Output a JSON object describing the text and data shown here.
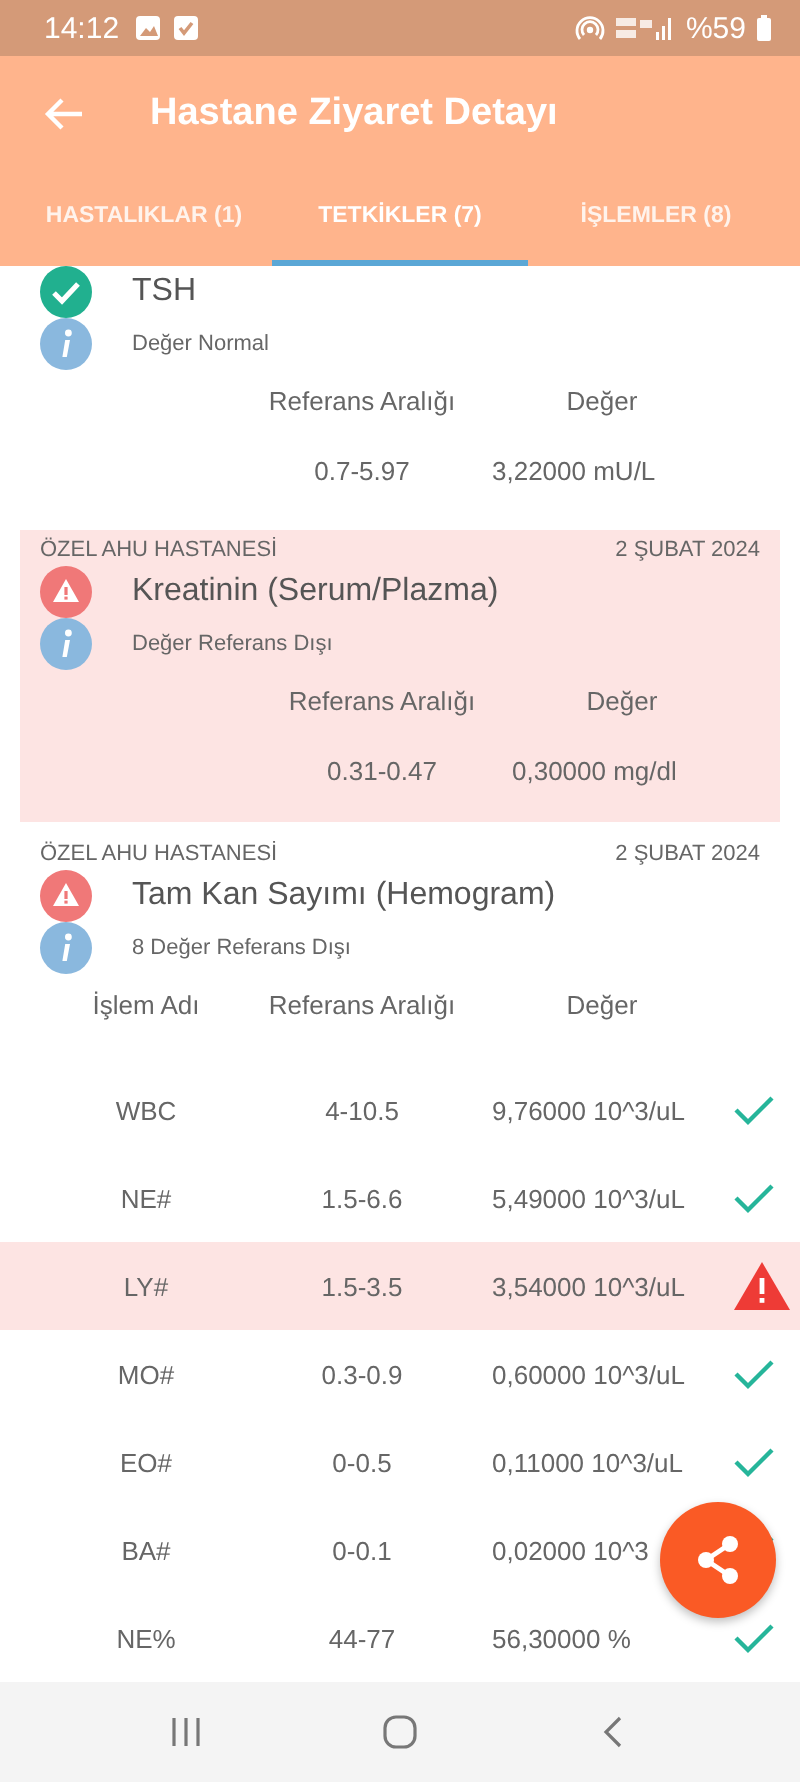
{
  "status_bar": {
    "time": "14:12",
    "battery": "%59"
  },
  "app_bar": {
    "title": "Hastane Ziyaret Detayı"
  },
  "tabs": [
    {
      "label": "HASTALIKLAR (1)",
      "selected": false
    },
    {
      "label": "TETKİKLER (7)",
      "selected": true
    },
    {
      "label": "İŞLEMLER (8)",
      "selected": false
    }
  ],
  "tests": [
    {
      "name": "TSH",
      "kind": "normal",
      "highlighted": false,
      "note": "Değer Normal",
      "columns": [
        "Referans Aralığı",
        "Değer"
      ],
      "rows": [
        {
          "range": "0.7-5.97",
          "value": "3,22000 mU/L"
        }
      ]
    },
    {
      "hospital": "ÖZEL AHU HASTANESİ",
      "date": "2 ŞUBAT 2024",
      "name": "Kreatinin (Serum/Plazma)",
      "kind": "abnormal",
      "highlighted": true,
      "note": "Değer Referans Dışı",
      "columns": [
        "Referans Aralığı",
        "Değer"
      ],
      "rows": [
        {
          "range": "0.31-0.47",
          "value": "0,30000 mg/dl"
        }
      ]
    },
    {
      "hospital": "ÖZEL AHU HASTANESİ",
      "date": "2 ŞUBAT 2024",
      "name": "Tam Kan Sayımı (Hemogram)",
      "kind": "abnormal",
      "highlighted": false,
      "note": "8 Değer Referans Dışı",
      "columns": [
        "İşlem Adı",
        "Referans Aralığı",
        "Değer"
      ],
      "rows": [
        {
          "item": "WBC",
          "range": "4-10.5",
          "value": "9,76000 10^3/uL",
          "kind": "normal"
        },
        {
          "item": "NE#",
          "range": "1.5-6.6",
          "value": "5,49000 10^3/uL",
          "kind": "normal"
        },
        {
          "item": "LY#",
          "range": "1.5-3.5",
          "value": "3,54000 10^3/uL",
          "kind": "abnormal"
        },
        {
          "item": "MO#",
          "range": "0.3-0.9",
          "value": "0,60000 10^3/uL",
          "kind": "normal"
        },
        {
          "item": "EO#",
          "range": "0-0.5",
          "value": "0,11000 10^3/uL",
          "kind": "normal"
        },
        {
          "item": "BA#",
          "range": "0-0.1",
          "value": "0,02000 10^3",
          "kind": "normal"
        },
        {
          "item": "NE%",
          "range": "44-77",
          "value": "56,30000 %",
          "kind": "normal"
        }
      ]
    }
  ]
}
